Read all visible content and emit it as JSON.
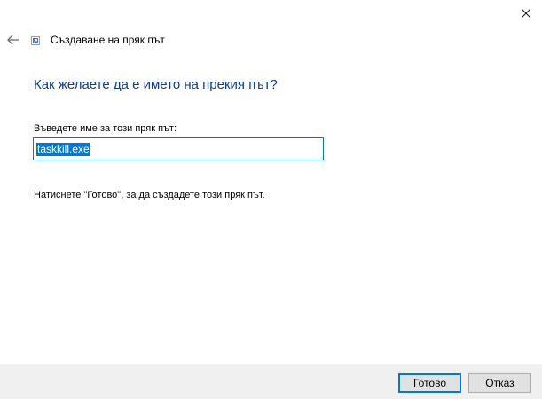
{
  "window": {
    "title": "Създаване на пряк път",
    "back_icon": "arrow-left-icon",
    "close_icon": "close-icon",
    "shortcut_icon": "shortcut-icon"
  },
  "main": {
    "heading": "Как желаете да е името на прекия път?",
    "field_label": "Въведете име за този пряк път:",
    "name_value": "taskkill.exe",
    "instruction": "Натиснете \"Готово\", за да създадете този пряк път."
  },
  "footer": {
    "finish_label": "Готово",
    "cancel_label": "Отказ"
  },
  "colors": {
    "heading": "#0a3d91",
    "accent": "#0078d7",
    "footer_bg": "#f0f0f0"
  }
}
